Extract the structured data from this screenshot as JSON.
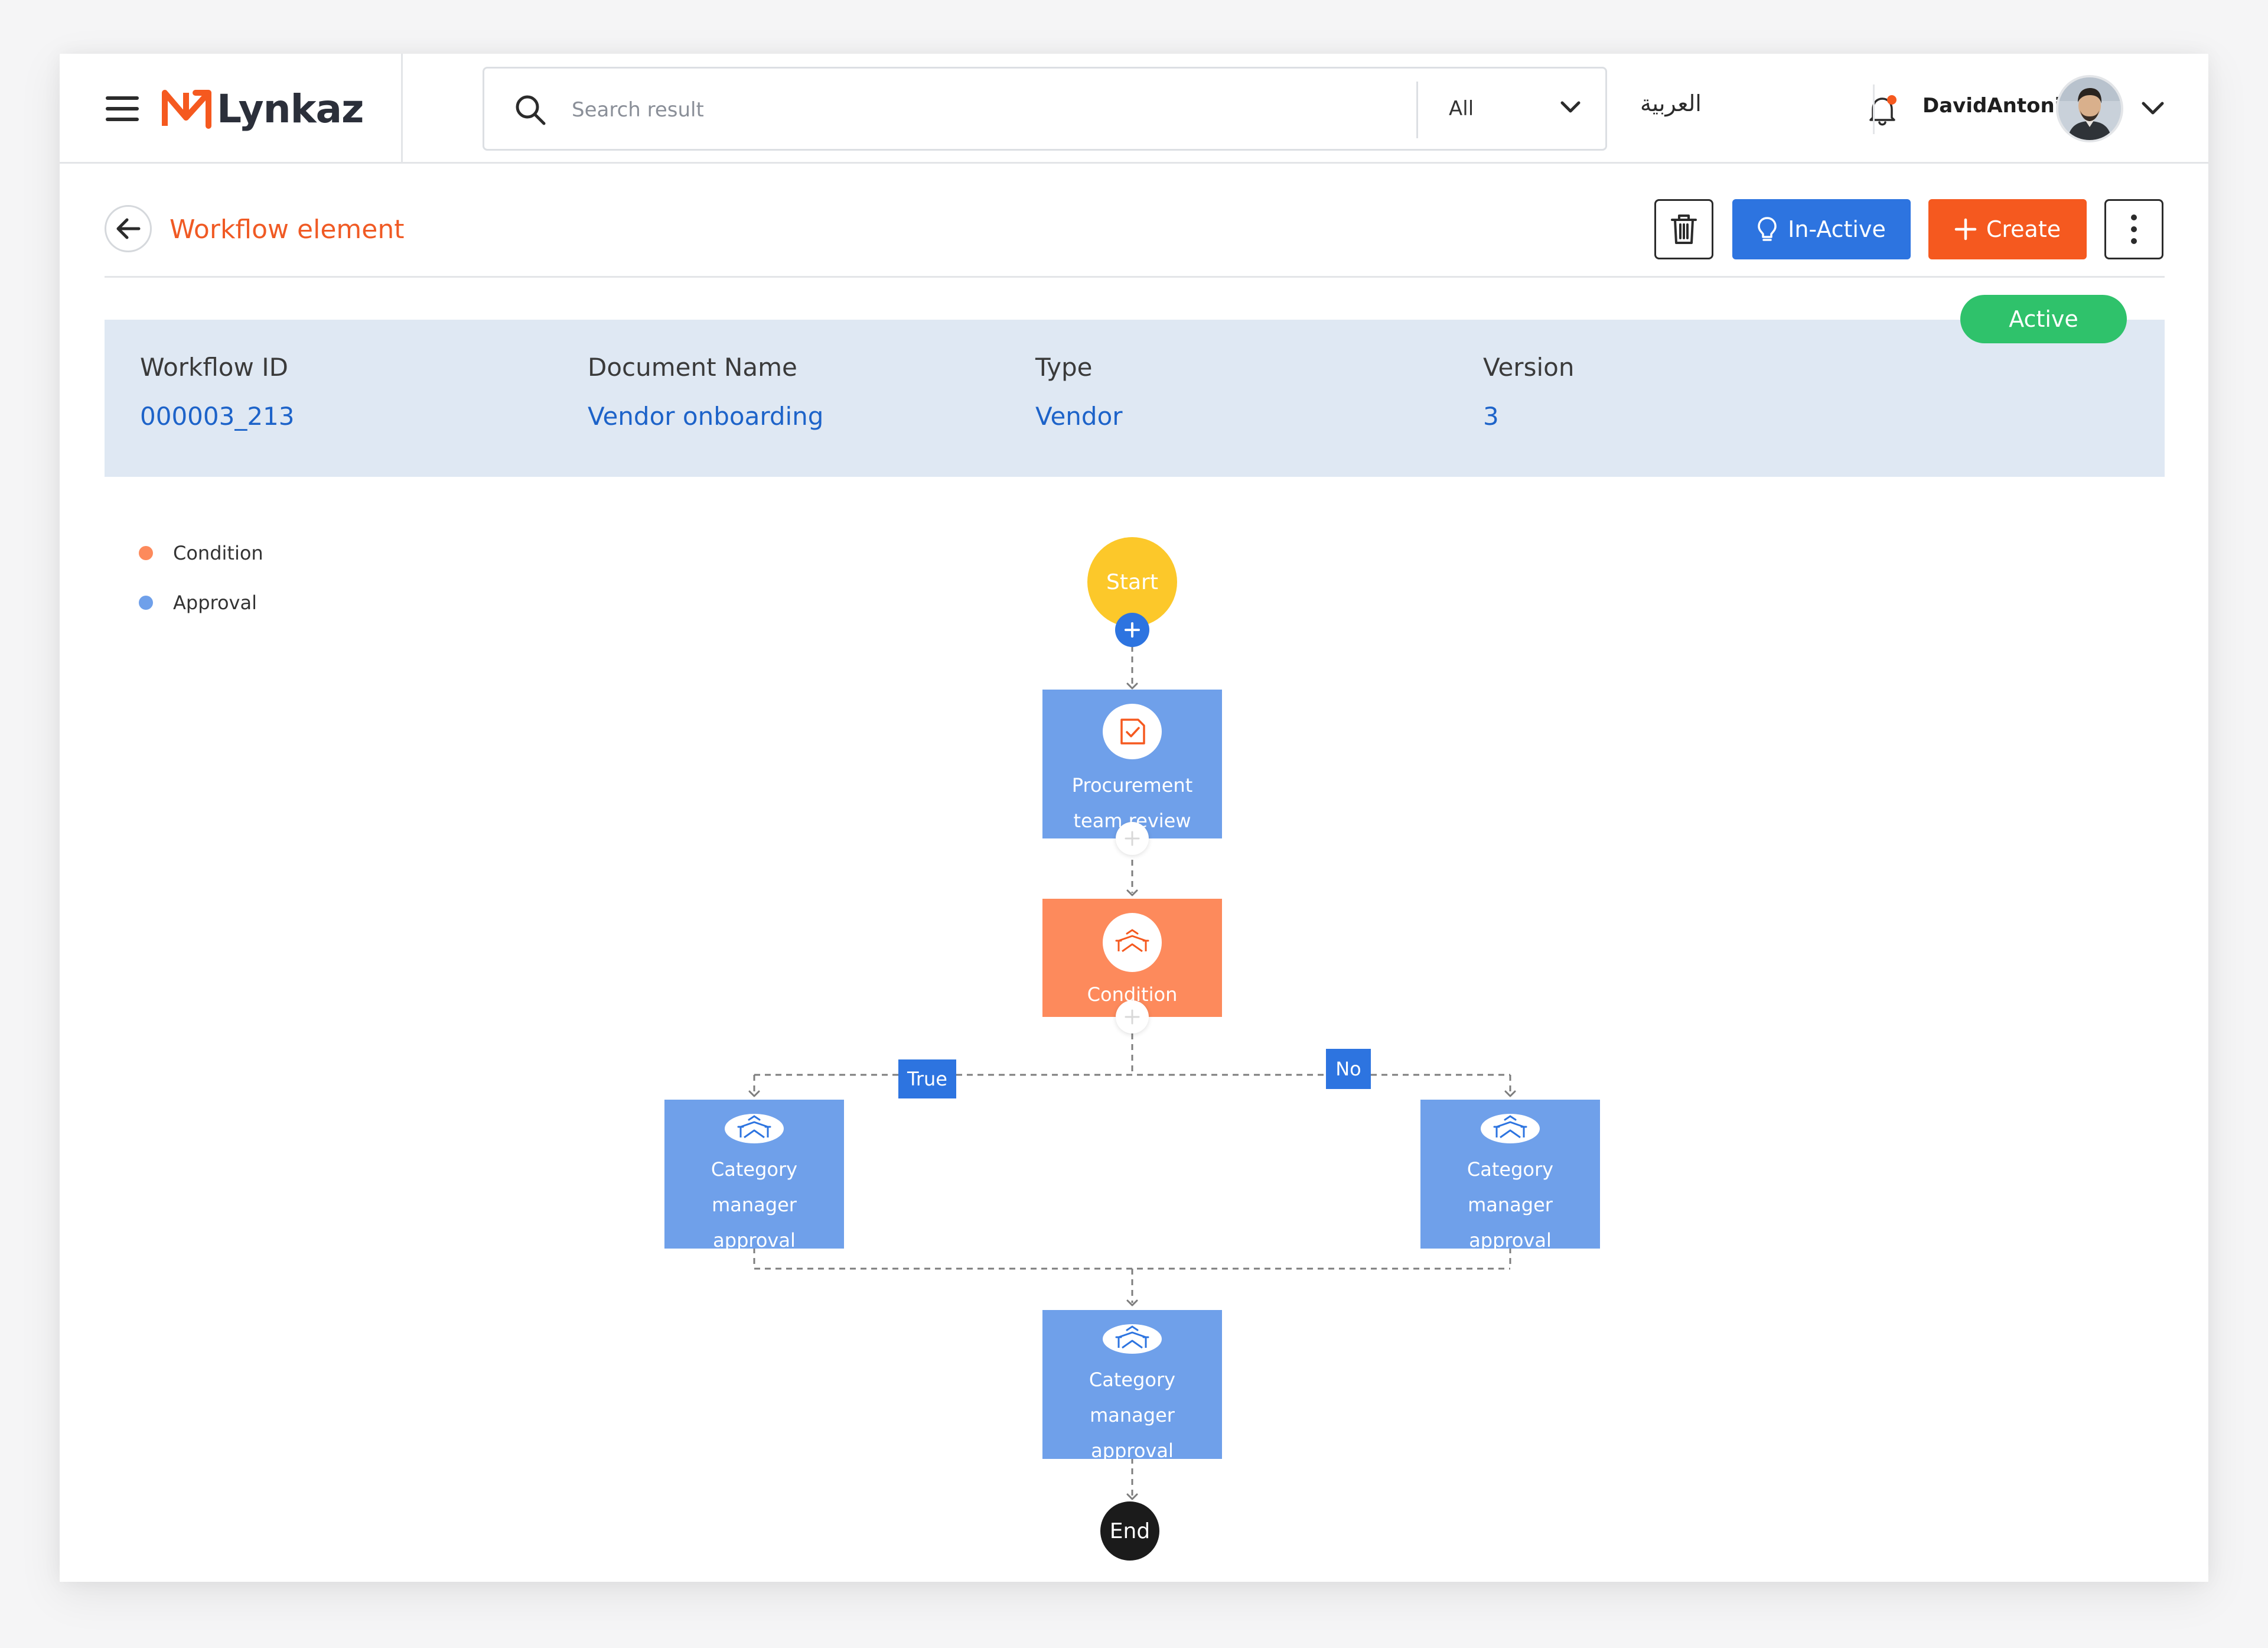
{
  "app": {
    "brand": "Lynkaz"
  },
  "search": {
    "placeholder": "Search result",
    "scope": "All"
  },
  "header": {
    "language": "العربية",
    "username": "DavidAntonio"
  },
  "page": {
    "title": "Workflow element",
    "status": "Active",
    "actions": {
      "inactive_label": "In-Active",
      "create_label": "Create"
    }
  },
  "info": [
    {
      "label": "Workflow ID",
      "value": "000003_213"
    },
    {
      "label": "Document Name",
      "value": "Vendor onboarding"
    },
    {
      "label": "Type",
      "value": "Vendor"
    },
    {
      "label": "Version",
      "value": "3"
    }
  ],
  "legend": [
    {
      "label": "Condition",
      "color": "#fd8a5c"
    },
    {
      "label": "Approval",
      "color": "#6fa0ea"
    }
  ],
  "workflow": {
    "start": "Start",
    "end": "End",
    "review": {
      "line1": "Procurement",
      "line2": "team review"
    },
    "condition": "Condition",
    "branch_true": "True",
    "branch_no": "No",
    "approval_left": {
      "line1": "Category manager",
      "line2": "approval"
    },
    "approval_right": {
      "line1": "Category manager",
      "line2": "approval"
    },
    "approval_final": {
      "line1": "Category manager",
      "line2": "approval"
    }
  },
  "colors": {
    "brand_orange": "#f5591f",
    "primary_blue": "#2d74e0",
    "active_green": "#2fc26b",
    "start_yellow": "#fcc82a",
    "approval_blue": "#6fa0ea",
    "condition_orange": "#fd8a5c"
  }
}
